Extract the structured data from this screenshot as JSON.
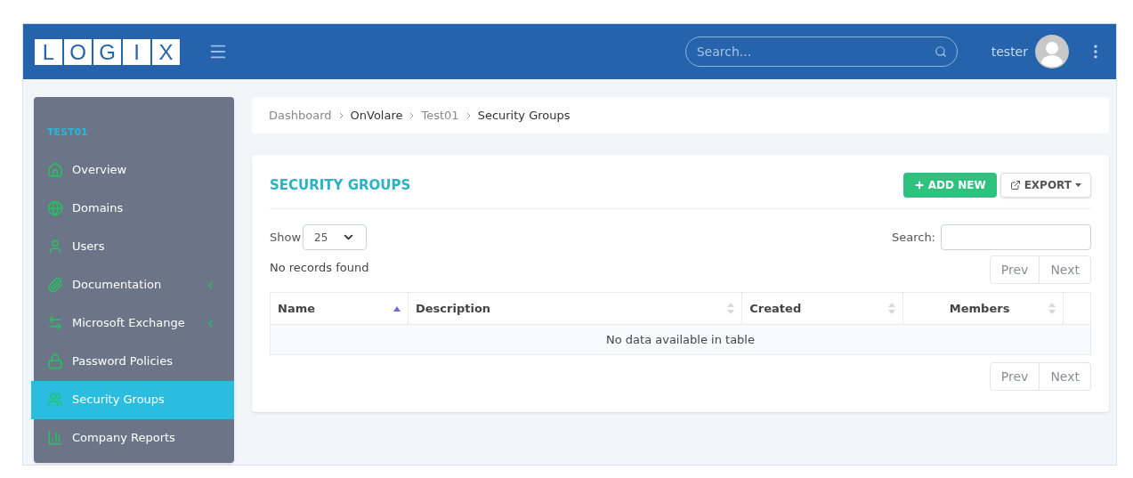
{
  "header": {
    "logo": [
      "L",
      "O",
      "G",
      "I",
      "X"
    ],
    "search": {
      "placeholder": "Search..."
    },
    "user": "tester"
  },
  "sidebar": {
    "title": "TEST01",
    "items": [
      {
        "label": "Overview",
        "expandable": false,
        "selected": false
      },
      {
        "label": "Domains",
        "expandable": false,
        "selected": false
      },
      {
        "label": "Users",
        "expandable": false,
        "selected": false
      },
      {
        "label": "Documentation",
        "expandable": true,
        "selected": false
      },
      {
        "label": "Microsoft Exchange",
        "expandable": true,
        "selected": false
      },
      {
        "label": "Password Policies",
        "expandable": false,
        "selected": false
      },
      {
        "label": "Security Groups",
        "expandable": false,
        "selected": true
      },
      {
        "label": "Company Reports",
        "expandable": false,
        "selected": false
      }
    ]
  },
  "breadcrumb": [
    {
      "label": "Dashboard",
      "current": false
    },
    {
      "label": "OnVolare",
      "current": true
    },
    {
      "label": "Test01",
      "current": false
    },
    {
      "label": "Security Groups",
      "current": true
    }
  ],
  "panel": {
    "title": "SECURITY GROUPS",
    "add_button": "ADD NEW",
    "export_button": "EXPORT",
    "show_label": "Show",
    "page_size": "25",
    "search_label": "Search:",
    "status": "No records found",
    "pager_top": [
      "Prev",
      "Next"
    ],
    "pager_bottom": [
      "Prev",
      "Next"
    ],
    "table": {
      "columns": [
        {
          "label": "Name",
          "sorted": true
        },
        {
          "label": "Description",
          "sorted": false
        },
        {
          "label": "Created",
          "sorted": false
        },
        {
          "label": "Members",
          "sorted": false
        }
      ],
      "empty_message": "No data available in table"
    }
  }
}
